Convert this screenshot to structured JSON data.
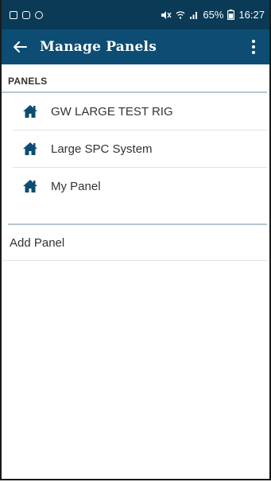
{
  "statusbar": {
    "left_icons": [
      "gallery-icon",
      "sim-icon",
      "sync-icon"
    ],
    "right_icons": [
      "mute-icon",
      "wifi-icon",
      "signal-icon"
    ],
    "battery": "65%",
    "battery_icon": "battery-icon",
    "time": "16:27"
  },
  "appbar": {
    "back_icon": "arrow-left-icon",
    "title": "Manage Panels",
    "menu_icon": "more-vert-icon"
  },
  "panels": {
    "header": "PANELS",
    "items": [
      {
        "label": "GW LARGE TEST RIG",
        "icon": "home-icon"
      },
      {
        "label": "Large SPC System",
        "icon": "home-icon"
      },
      {
        "label": "My Panel",
        "icon": "home-icon"
      }
    ]
  },
  "add_panel": {
    "label": "Add Panel"
  },
  "colors": {
    "statusbar": "#0a3a55",
    "appbar": "#0d4d73",
    "icon": "#0d4d73",
    "divider": "#b9c6cf"
  }
}
